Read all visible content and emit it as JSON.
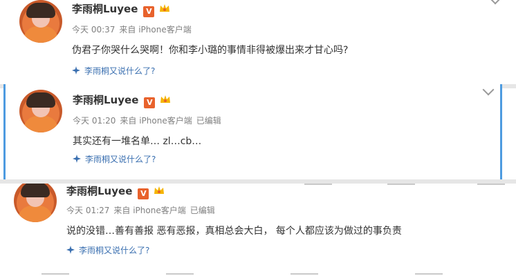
{
  "posts": [
    {
      "username": "李雨桐Luyee",
      "vbadge": "V",
      "time": "今天 00:37",
      "source": "来自 iPhone客户端",
      "edited": "",
      "content": "伪君子你哭什么哭啊！你和李小璐的事情非得被爆出来才甘心吗?",
      "topic": "李雨桐又说什么了?"
    },
    {
      "username": "李雨桐Luyee",
      "vbadge": "V",
      "time": "今天 01:20",
      "source": "来自 iPhone客户端",
      "edited": "已编辑",
      "content": "其实还有一堆名单… zl…cb…",
      "topic": "李雨桐又说什么了?"
    },
    {
      "username": "李雨桐Luyee",
      "vbadge": "V",
      "time": "今天 01:27",
      "source": "来自 iPhone客户端",
      "edited": "已编辑",
      "content": "说的没错…善有善报 恶有恶报，真相总会大白， 每个人都应该为做过的事负责",
      "topic": "李雨桐又说什么了?"
    }
  ],
  "colors": {
    "accent_link": "#3a6fb0",
    "verified_badge": "#e8622c",
    "panel_border": "#4d9be0"
  }
}
